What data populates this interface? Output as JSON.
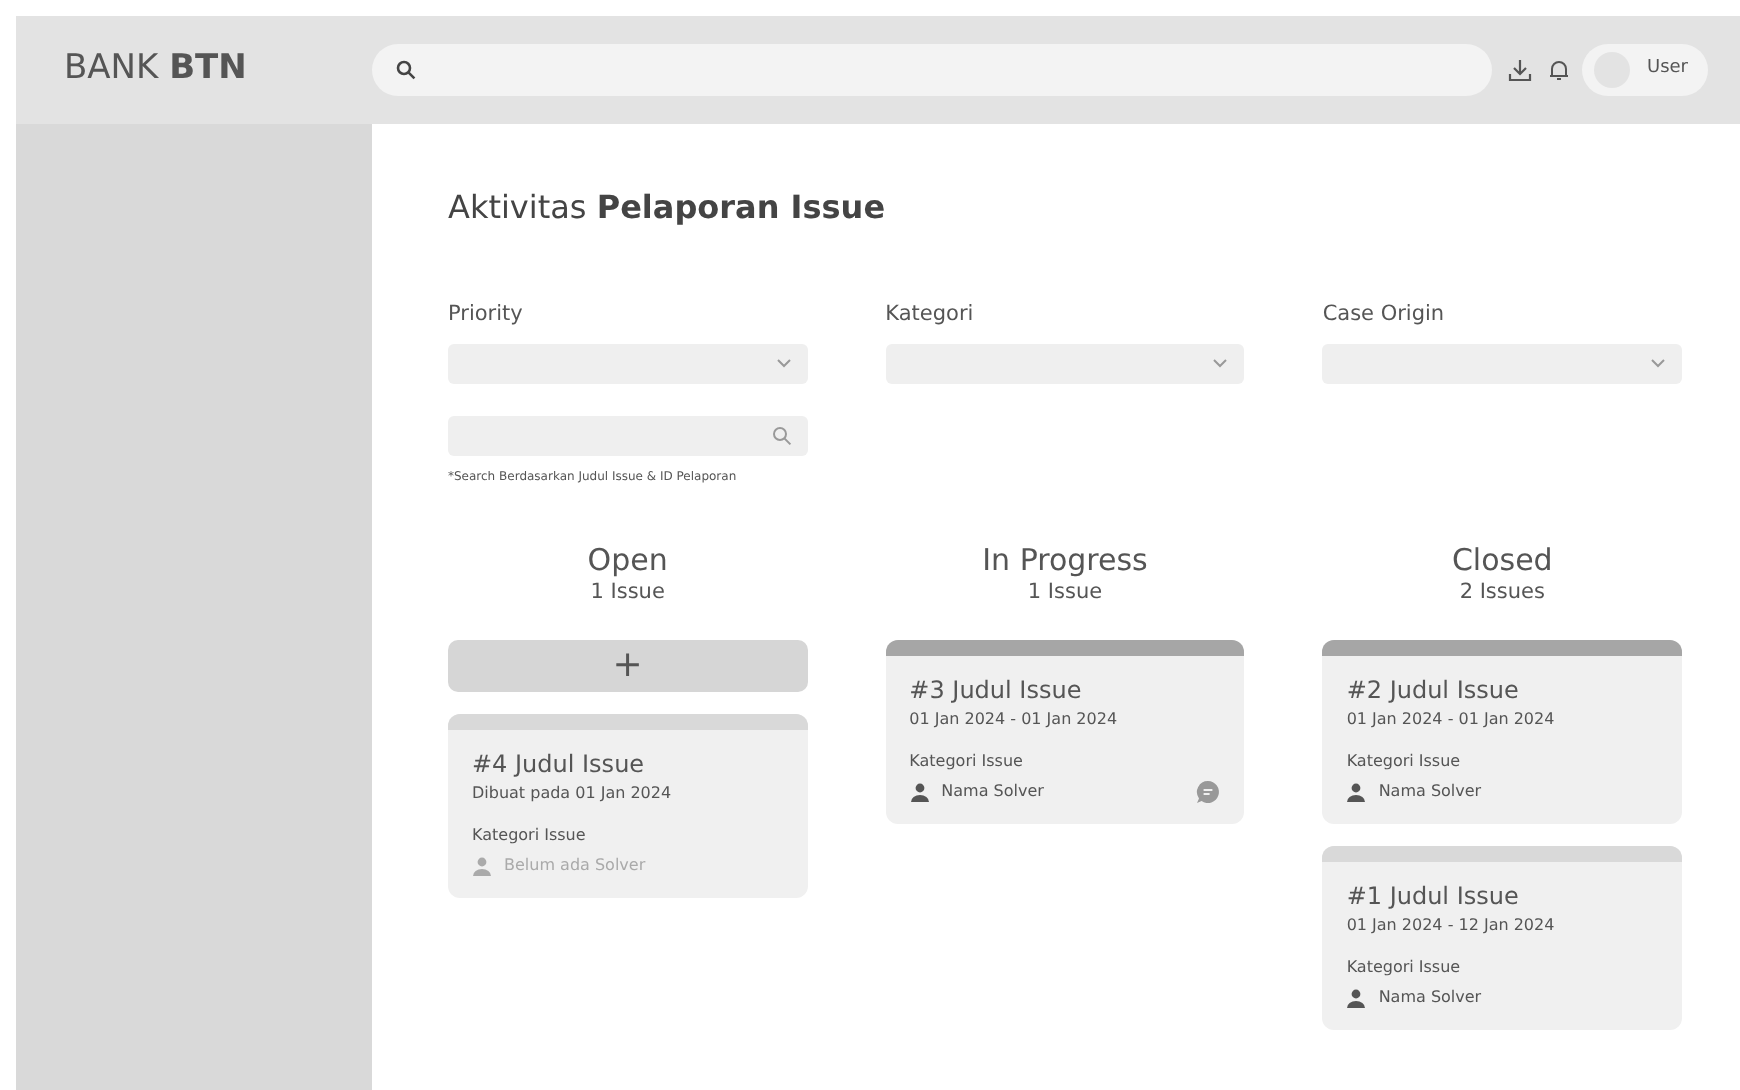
{
  "brand": "BANK **BTN**",
  "header": {
    "user": "User"
  },
  "page_title": "Aktivitas **Pelaporan Issue**",
  "filters": [
    {
      "label": "Priority"
    },
    {
      "label": "Kategori"
    },
    {
      "label": "Case Origin"
    }
  ],
  "search": {
    "note": "*Search Berdasarkan Judul Issue & ID Pelaporan"
  },
  "columns": [
    {
      "title": "Open",
      "count": "1 Issue",
      "add_button": "+",
      "cards": [
        {
          "title": "#4 Judul Issue",
          "date": "Dibuat pada 01 Jan 2024",
          "category": "Kategori Issue",
          "solver": "Belum ada Solver",
          "has_solver": false,
          "comment": false,
          "color": "#d9d9d9"
        }
      ]
    },
    {
      "title": "In Progress",
      "count": "1 Issue",
      "cards": [
        {
          "title": "#3 Judul Issue",
          "date": "01 Jan 2024 - 01 Jan 2024",
          "category": "Kategori Issue",
          "solver": "Nama Solver",
          "has_solver": true,
          "comment": true,
          "color": "#a6a6a6"
        }
      ]
    },
    {
      "title": "Closed",
      "count": "2 Issues",
      "cards": [
        {
          "title": "#2 Judul Issue",
          "date": "01 Jan 2024 - 01 Jan 2024",
          "category": "Kategori Issue",
          "solver": "Nama Solver",
          "has_solver": true,
          "comment": false,
          "color": "#a6a6a6"
        },
        {
          "title": "#1 Judul Issue",
          "date": "01 Jan 2024 - 12 Jan 2024",
          "category": "Kategori Issue",
          "solver": "Nama Solver",
          "has_solver": true,
          "comment": false,
          "color": "#d9d9d9"
        }
      ]
    }
  ]
}
